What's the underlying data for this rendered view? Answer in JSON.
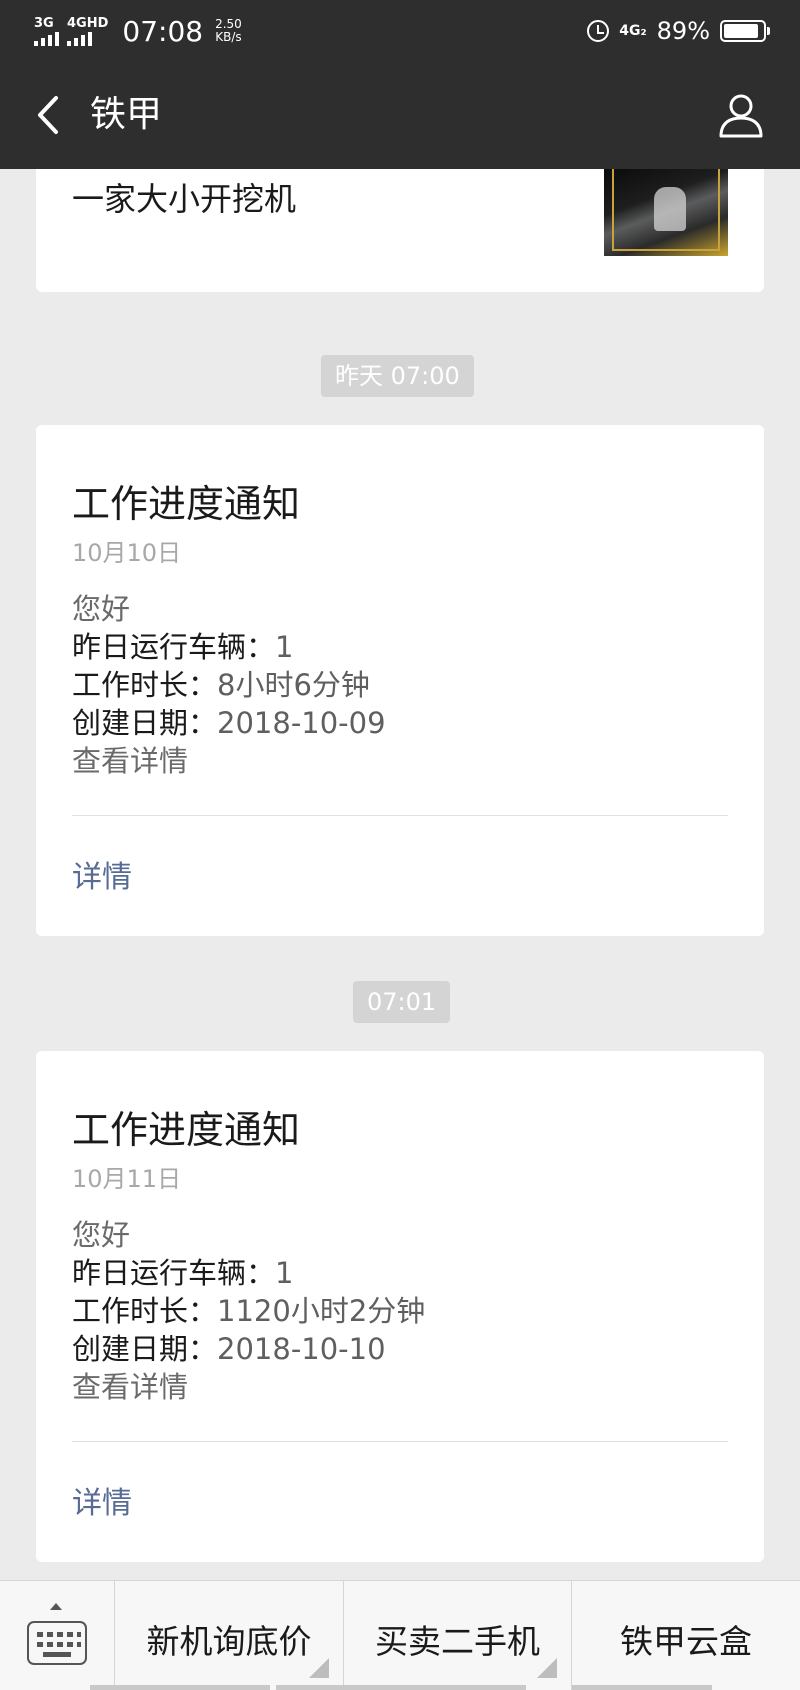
{
  "status_bar": {
    "signal1": "3G",
    "signal2": "4GHD",
    "time": "07:08",
    "speed_value": "2.50",
    "speed_unit": "KB/s",
    "network": "4G₂",
    "battery": "89%",
    "battery_level": 0.89
  },
  "nav": {
    "title": "铁甲",
    "back_icon": "chevron-left-icon",
    "profile_icon": "user-icon"
  },
  "top_card": {
    "text": "一家大小开挖机"
  },
  "messages": [
    {
      "timestamp": "昨天 07:00",
      "title": "工作进度通知",
      "date": "10月10日",
      "greeting": "您好",
      "vehicles_label": "昨日运行车辆：",
      "vehicles_value": "1",
      "duration_label": "工作时长：",
      "duration_value": "8小时6分钟",
      "created_label": "创建日期：",
      "created_value": "2018-10-09",
      "view_text": "查看详情",
      "detail_link": "详情"
    },
    {
      "timestamp": "07:01",
      "title": "工作进度通知",
      "date": "10月11日",
      "greeting": "您好",
      "vehicles_label": "昨日运行车辆：",
      "vehicles_value": "1",
      "duration_label": "工作时长：",
      "duration_value": "1120小时2分钟",
      "created_label": "创建日期：",
      "created_value": "2018-10-10",
      "view_text": "查看详情",
      "detail_link": "详情"
    }
  ],
  "menu": {
    "keyboard_icon": "keyboard-icon",
    "items": [
      {
        "label": "新机询底价"
      },
      {
        "label": "买卖二手机"
      },
      {
        "label": "铁甲云盒"
      }
    ]
  },
  "colors": {
    "bar_bg": "#2e2e2e",
    "page_bg": "#ebebeb",
    "link": "#576b95"
  }
}
